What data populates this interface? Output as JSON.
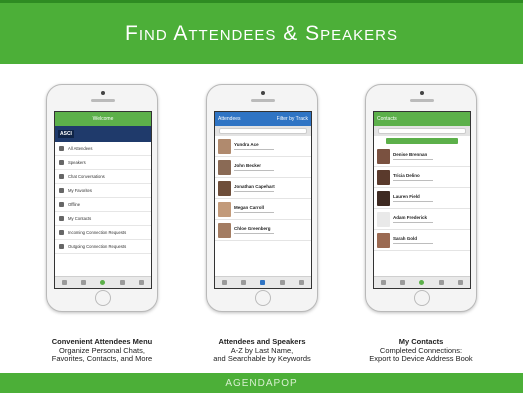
{
  "header": {
    "title": "Find Attendees & Speakers"
  },
  "phones": [
    {
      "nav_title": "Welcome",
      "banner_logo": "ASCI",
      "menu": [
        "All Attendees",
        "Speakers",
        "Chat Conversations",
        "My Favorites",
        "Offline",
        "My Contacts",
        "Incoming Connection Requests",
        "Outgoing Connection Requests"
      ]
    },
    {
      "nav_back": "Attendees",
      "nav_right": "Filter by Track",
      "people": [
        "Yundra Ace",
        "John Becker",
        "Jonathan Capehart",
        "Megan Carroll",
        "Chloe Greenberg"
      ]
    },
    {
      "nav_back": "Contacts",
      "people": [
        "Denise Brennan",
        "Tricia Delino",
        "Lauren Field",
        "Adam Frederick",
        "Sarah Gold"
      ]
    }
  ],
  "captions": [
    {
      "title": "Convenient Attendees Menu",
      "line1": "Organize Personal Chats,",
      "line2": "Favorites, Contacts, and More"
    },
    {
      "title": "Attendees and Speakers",
      "line1": "A-Z by Last Name,",
      "line2": "and Searchable by Keywords"
    },
    {
      "title": "My Contacts",
      "line1": "Completed Connections:",
      "line2": "Export to Device Address Book"
    }
  ],
  "footer": {
    "brand": "AGENDAPOP"
  },
  "colors": {
    "green": "#4caf38",
    "blue": "#2f74c4"
  }
}
